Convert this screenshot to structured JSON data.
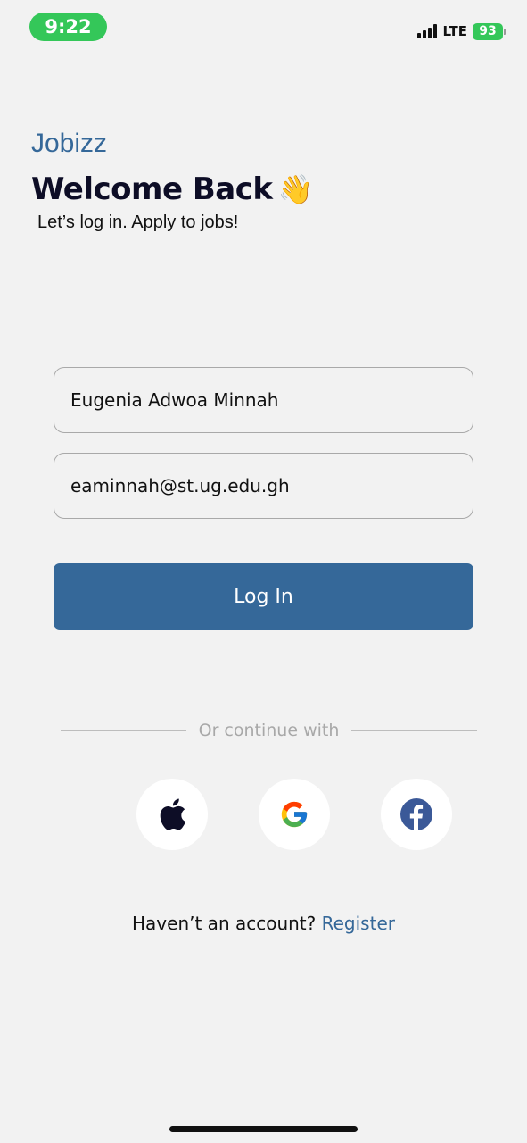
{
  "status_bar": {
    "time": "9:22",
    "network": "LTE",
    "battery": "93"
  },
  "header": {
    "brand": "Jobizz",
    "title": "Welcome Back",
    "wave_emoji": "👋",
    "subtitle": "Let’s log in. Apply to jobs!"
  },
  "form": {
    "name_value": "Eugenia Adwoa Minnah",
    "email_value": "eaminnah@st.ug.edu.gh",
    "login_label": "Log In"
  },
  "social": {
    "divider_text": "Or continue with",
    "providers": [
      {
        "name": "apple-icon"
      },
      {
        "name": "google-icon"
      },
      {
        "name": "facebook-icon"
      }
    ]
  },
  "footer": {
    "prompt": "Haven’t an account?",
    "register_label": "Register"
  },
  "colors": {
    "accent": "#356899",
    "background": "#f2f2f2",
    "status_green": "#34c759",
    "title_dark": "#0d0d26"
  }
}
